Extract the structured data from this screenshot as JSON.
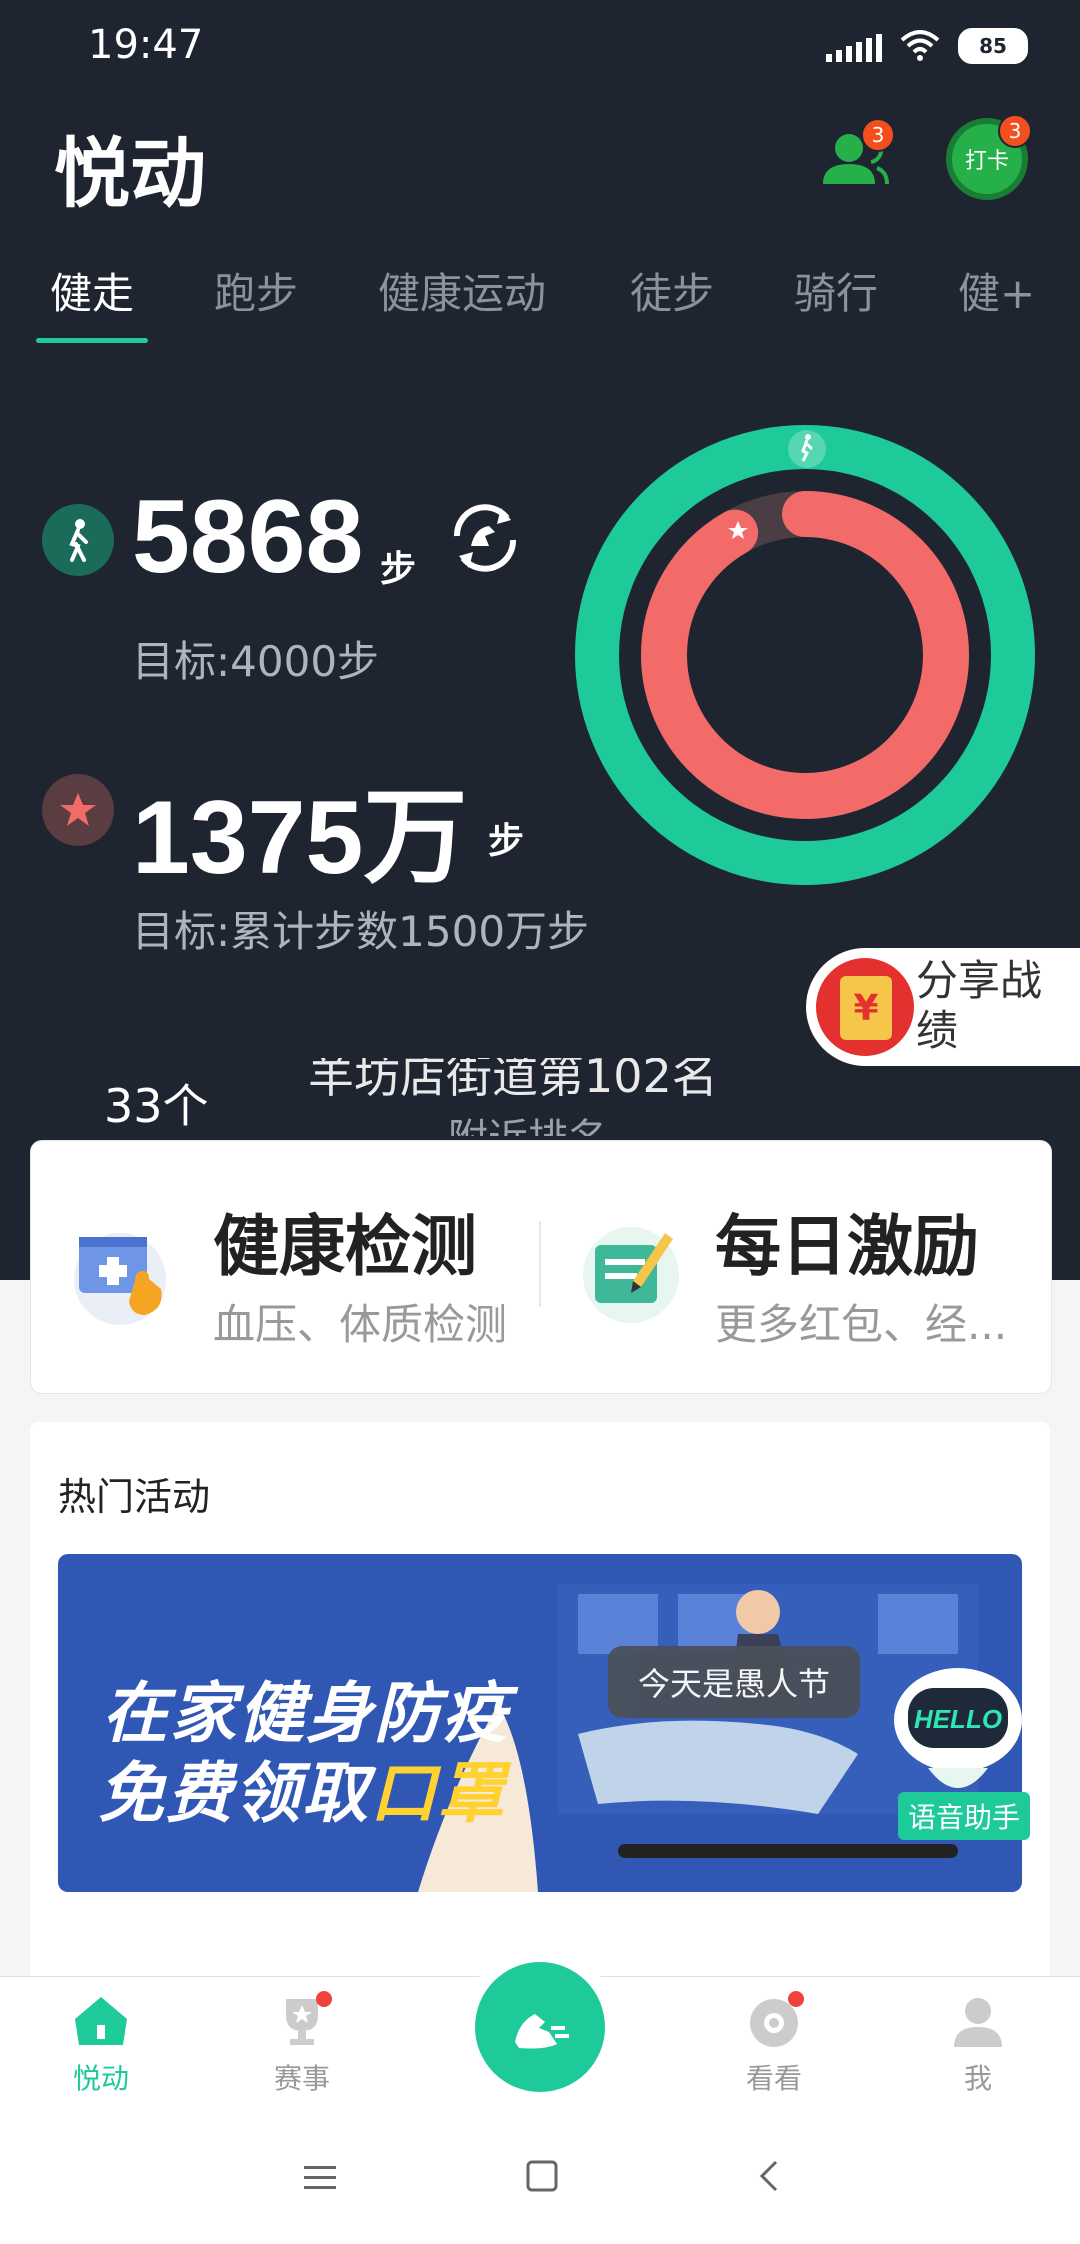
{
  "status": {
    "time": "19:47",
    "battery": "85"
  },
  "header": {
    "title": "悦动",
    "friends_badge": "3",
    "checkin_label": "打卡",
    "checkin_badge": "3"
  },
  "tabs": [
    "健走",
    "跑步",
    "健康运动",
    "徒步",
    "骑行",
    "健+"
  ],
  "steps": {
    "value": "5868",
    "unit": "步",
    "goal": "目标:4000步"
  },
  "total": {
    "value": "1375万",
    "unit": "步",
    "goal": "目标:累计步数1500万步"
  },
  "rings": {
    "outer_progress": 1.0,
    "inner_progress": 0.917,
    "outer_color": "#1ec99a",
    "inner_color": "#f26b68"
  },
  "share": {
    "label": "分享战绩"
  },
  "behind": {
    "count": "33个",
    "rank": "羊坊店街道第102名",
    "rank_sub": "附近排名"
  },
  "quick": {
    "left": {
      "title": "健康检测",
      "sub": "血压、体质检测"
    },
    "right": {
      "title": "每日激励",
      "sub": "更多红包、经..."
    }
  },
  "activities": {
    "title": "热门活动",
    "banner_line1": "在家健身防疫",
    "banner_line2a": "免费领取",
    "banner_line2b": "口罩",
    "tooltip": "今天是愚人节",
    "assistant_badge": "HELLO",
    "assistant_label": "语音助手"
  },
  "nav": [
    "悦动",
    "赛事",
    "看看",
    "我"
  ],
  "colors": {
    "accent": "#1ec99a",
    "dark_bg": "#1e2530",
    "ring_red": "#f26b68"
  }
}
